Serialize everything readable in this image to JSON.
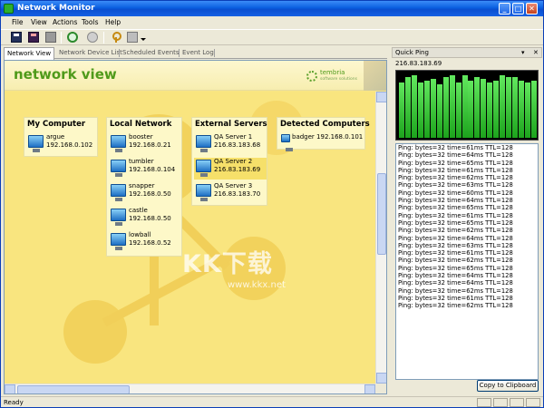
{
  "window": {
    "title": "Network Monitor"
  },
  "menu": [
    "File",
    "View",
    "Actions",
    "Tools",
    "Help"
  ],
  "tabs": [
    "Network View",
    "Network Device List",
    "Scheduled Events",
    "Event Log"
  ],
  "header": {
    "title": "network view",
    "brand": "tembria",
    "brand_sub": "software solutions"
  },
  "groups": [
    {
      "title": "My Computer",
      "devices": [
        {
          "name": "argue",
          "ip": "192.168.0.102"
        }
      ]
    },
    {
      "title": "Local Network",
      "devices": [
        {
          "name": "booster",
          "ip": "192.168.0.21"
        },
        {
          "name": "tumbler",
          "ip": "192.168.0.104"
        },
        {
          "name": "snapper",
          "ip": "192.168.0.50"
        },
        {
          "name": "castle",
          "ip": "192.168.0.50"
        },
        {
          "name": "lowball",
          "ip": "192.168.0.52"
        }
      ]
    },
    {
      "title": "External Servers",
      "devices": [
        {
          "name": "QA Server 1",
          "ip": "216.83.183.68"
        },
        {
          "name": "QA Server 2",
          "ip": "216.83.183.69",
          "selected": true
        },
        {
          "name": "QA Server 3",
          "ip": "216.83.183.70"
        }
      ]
    },
    {
      "title": "Detected Computers",
      "devices": [
        {
          "name": "badger",
          "ip": "192.168.0.101"
        }
      ]
    }
  ],
  "watermark": {
    "main": "KK下载",
    "url": "www.kkx.net"
  },
  "quickping": {
    "title": "Quick Ping",
    "ip": "216.83.183.69",
    "log": [
      "Ping: bytes=32 time=61ms TTL=128",
      "Ping: bytes=32 time=64ms TTL=128",
      "Ping: bytes=32 time=65ms TTL=128",
      "Ping: bytes=32 time=61ms TTL=128",
      "Ping: bytes=32 time=62ms TTL=128",
      "Ping: bytes=32 time=63ms TTL=128",
      "Ping: bytes=32 time=60ms TTL=128",
      "Ping: bytes=32 time=64ms TTL=128",
      "Ping: bytes=32 time=65ms TTL=128",
      "Ping: bytes=32 time=61ms TTL=128",
      "Ping: bytes=32 time=65ms TTL=128",
      "Ping: bytes=32 time=62ms TTL=128",
      "Ping: bytes=32 time=64ms TTL=128",
      "Ping: bytes=32 time=63ms TTL=128",
      "Ping: bytes=32 time=61ms TTL=128",
      "Ping: bytes=32 time=62ms TTL=128",
      "Ping: bytes=32 time=65ms TTL=128",
      "Ping: bytes=32 time=64ms TTL=128",
      "Ping: bytes=32 time=64ms TTL=128",
      "Ping: bytes=32 time=62ms TTL=128",
      "Ping: bytes=32 time=61ms TTL=128",
      "Ping: bytes=32 time=62ms TTL=128"
    ],
    "copy_label": "Copy to Clipboard"
  },
  "status": {
    "text": "Ready"
  }
}
